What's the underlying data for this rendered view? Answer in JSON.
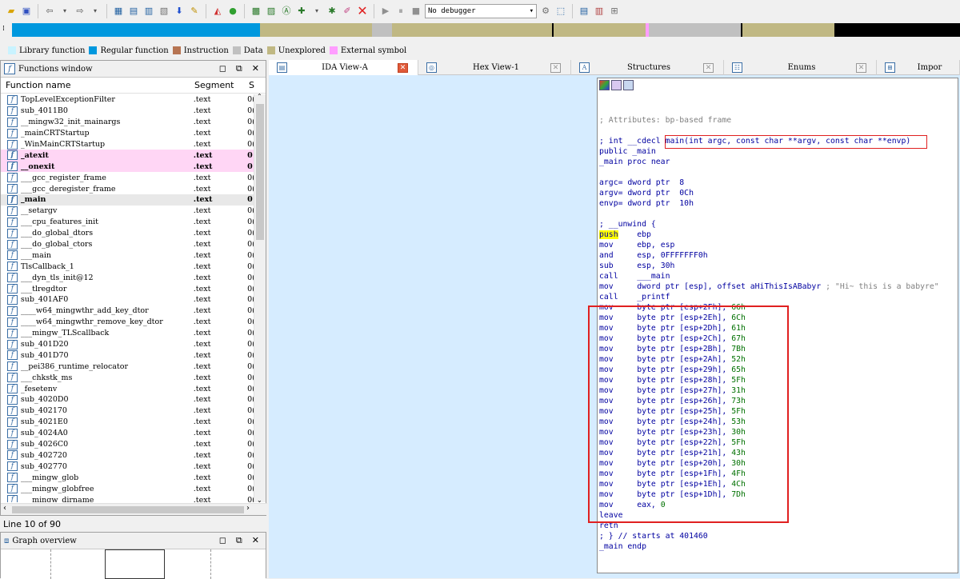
{
  "toolbar": {
    "debugger_select": "No debugger"
  },
  "legend": [
    {
      "label": "Library function",
      "color": "#c9f3ff"
    },
    {
      "label": "Regular function",
      "color": "#0098de"
    },
    {
      "label": "Instruction",
      "color": "#b67452"
    },
    {
      "label": "Data",
      "color": "#c0c0c0"
    },
    {
      "label": "Unexplored",
      "color": "#c0b883"
    },
    {
      "label": "External symbol",
      "color": "#ff9dff"
    }
  ],
  "functions_window": {
    "title": "Functions window",
    "col_name": "Function name",
    "col_segment": "Segment",
    "col_start": "S",
    "rows": [
      {
        "name": "TopLevelExceptionFilter",
        "seg": ".text",
        "s": "0("
      },
      {
        "name": "sub_4011B0",
        "seg": ".text",
        "s": "0("
      },
      {
        "name": "__mingw32_init_mainargs",
        "seg": ".text",
        "s": "0("
      },
      {
        "name": "_mainCRTStartup",
        "seg": ".text",
        "s": "0("
      },
      {
        "name": "_WinMainCRTStartup",
        "seg": ".text",
        "s": "0("
      },
      {
        "name": "_atexit",
        "seg": ".text",
        "s": "0"
      },
      {
        "name": "__onexit",
        "seg": ".text",
        "s": "0"
      },
      {
        "name": "___gcc_register_frame",
        "seg": ".text",
        "s": "0("
      },
      {
        "name": "___gcc_deregister_frame",
        "seg": ".text",
        "s": "0("
      },
      {
        "name": "_main",
        "seg": ".text",
        "s": "0"
      },
      {
        "name": "__setargv",
        "seg": ".text",
        "s": "0("
      },
      {
        "name": "___cpu_features_init",
        "seg": ".text",
        "s": "0("
      },
      {
        "name": "___do_global_dtors",
        "seg": ".text",
        "s": "0("
      },
      {
        "name": "___do_global_ctors",
        "seg": ".text",
        "s": "0("
      },
      {
        "name": "___main",
        "seg": ".text",
        "s": "0("
      },
      {
        "name": "TlsCallback_1",
        "seg": ".text",
        "s": "0("
      },
      {
        "name": "___dyn_tls_init@12",
        "seg": ".text",
        "s": "0("
      },
      {
        "name": "___tlregdtor",
        "seg": ".text",
        "s": "0("
      },
      {
        "name": "sub_401AF0",
        "seg": ".text",
        "s": "0("
      },
      {
        "name": "____w64_mingwthr_add_key_dtor",
        "seg": ".text",
        "s": "0("
      },
      {
        "name": "____w64_mingwthr_remove_key_dtor",
        "seg": ".text",
        "s": "0("
      },
      {
        "name": "___mingw_TLScallback",
        "seg": ".text",
        "s": "0("
      },
      {
        "name": "sub_401D20",
        "seg": ".text",
        "s": "0("
      },
      {
        "name": "sub_401D70",
        "seg": ".text",
        "s": "0("
      },
      {
        "name": "__pei386_runtime_relocator",
        "seg": ".text",
        "s": "0("
      },
      {
        "name": "___chkstk_ms",
        "seg": ".text",
        "s": "0("
      },
      {
        "name": "_fesetenv",
        "seg": ".text",
        "s": "0("
      },
      {
        "name": "sub_4020D0",
        "seg": ".text",
        "s": "0("
      },
      {
        "name": "sub_402170",
        "seg": ".text",
        "s": "0("
      },
      {
        "name": "sub_4021E0",
        "seg": ".text",
        "s": "0("
      },
      {
        "name": "sub_4024A0",
        "seg": ".text",
        "s": "0("
      },
      {
        "name": "sub_4026C0",
        "seg": ".text",
        "s": "0("
      },
      {
        "name": "sub_402720",
        "seg": ".text",
        "s": "0("
      },
      {
        "name": "sub_402770",
        "seg": ".text",
        "s": "0("
      },
      {
        "name": "___mingw_glob",
        "seg": ".text",
        "s": "0("
      },
      {
        "name": "___mingw_globfree",
        "seg": ".text",
        "s": "0("
      },
      {
        "name": "___mingw_dirname",
        "seg": ".text",
        "s": "0("
      }
    ],
    "line_info": "Line 10 of 90"
  },
  "graph_overview": {
    "title": "Graph overview"
  },
  "tabs": [
    {
      "label": "IDA View-A",
      "icon": "ida-view-icon",
      "active": true
    },
    {
      "label": "Hex View-1",
      "icon": "hex-view-icon",
      "active": false
    },
    {
      "label": "Structures",
      "icon": "structures-icon",
      "active": false
    },
    {
      "label": "Enums",
      "icon": "enums-icon",
      "active": false
    },
    {
      "label": "Impor",
      "icon": "imports-icon",
      "active": false
    }
  ],
  "code": {
    "attributes": "; Attributes: bp-based frame",
    "sig_prefix": "; int __cdecl ",
    "sig_rest": "main(int argc, const char **argv, const char **envp)",
    "public": "public _main",
    "proc": "_main proc near",
    "vars": [
      "argc= dword ptr  8",
      "argv= dword ptr  0Ch",
      "envp= dword ptr  10h"
    ],
    "unwind": "; __unwind {",
    "prologue": [
      {
        "op": "push",
        "args": "ebp"
      },
      {
        "op": "mov",
        "args": "ebp, esp"
      },
      {
        "op": "and",
        "args": "esp, 0FFFFFFF0h"
      },
      {
        "op": "sub",
        "args": "esp, 30h"
      },
      {
        "op": "call",
        "args": "___main"
      },
      {
        "op": "mov",
        "args": "dword ptr [esp], offset aHiThisIsABabyr",
        "comment": "; \"Hi~ this is a babyre\""
      },
      {
        "op": "call",
        "args": "_printf"
      }
    ],
    "movs": [
      {
        "dst": "byte ptr [esp+2Fh],",
        "val": "66h"
      },
      {
        "dst": "byte ptr [esp+2Eh],",
        "val": "6Ch"
      },
      {
        "dst": "byte ptr [esp+2Dh],",
        "val": "61h"
      },
      {
        "dst": "byte ptr [esp+2Ch],",
        "val": "67h"
      },
      {
        "dst": "byte ptr [esp+2Bh],",
        "val": "7Bh"
      },
      {
        "dst": "byte ptr [esp+2Ah],",
        "val": "52h"
      },
      {
        "dst": "byte ptr [esp+29h],",
        "val": "65h"
      },
      {
        "dst": "byte ptr [esp+28h],",
        "val": "5Fh"
      },
      {
        "dst": "byte ptr [esp+27h],",
        "val": "31h"
      },
      {
        "dst": "byte ptr [esp+26h],",
        "val": "73h"
      },
      {
        "dst": "byte ptr [esp+25h],",
        "val": "5Fh"
      },
      {
        "dst": "byte ptr [esp+24h],",
        "val": "53h"
      },
      {
        "dst": "byte ptr [esp+23h],",
        "val": "30h"
      },
      {
        "dst": "byte ptr [esp+22h],",
        "val": "5Fh"
      },
      {
        "dst": "byte ptr [esp+21h],",
        "val": "43h"
      },
      {
        "dst": "byte ptr [esp+20h],",
        "val": "30h"
      },
      {
        "dst": "byte ptr [esp+1Fh],",
        "val": "4Fh"
      },
      {
        "dst": "byte ptr [esp+1Eh],",
        "val": "4Ch"
      },
      {
        "dst": "byte ptr [esp+1Dh],",
        "val": "7Dh"
      },
      {
        "dst": "eax,",
        "val": "0"
      }
    ],
    "leave": "leave",
    "retn": "retn",
    "unwind_end": "; } // starts at 401460",
    "endp": "_main endp"
  }
}
